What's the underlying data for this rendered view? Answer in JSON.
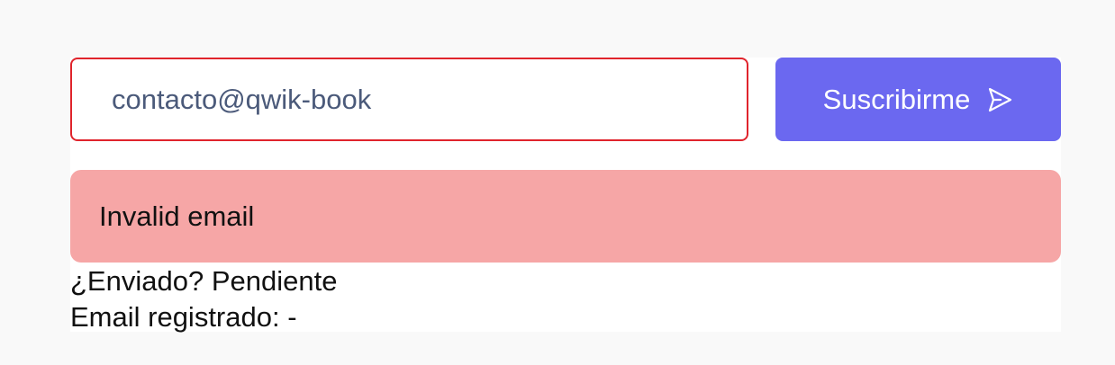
{
  "form": {
    "email_value": "contacto@qwik-book",
    "submit_label": "Suscribirme",
    "submit_icon": "send-icon"
  },
  "error": {
    "message": "Invalid email"
  },
  "status": {
    "sent_label": "¿Enviado?",
    "sent_value": "Pendiente",
    "registered_label": "Email registrado:",
    "registered_value": "-"
  },
  "colors": {
    "accent": "#6b68f0",
    "error_border": "#e0242c",
    "error_background": "#f6a6a6",
    "page_background": "#f9f9f9"
  }
}
